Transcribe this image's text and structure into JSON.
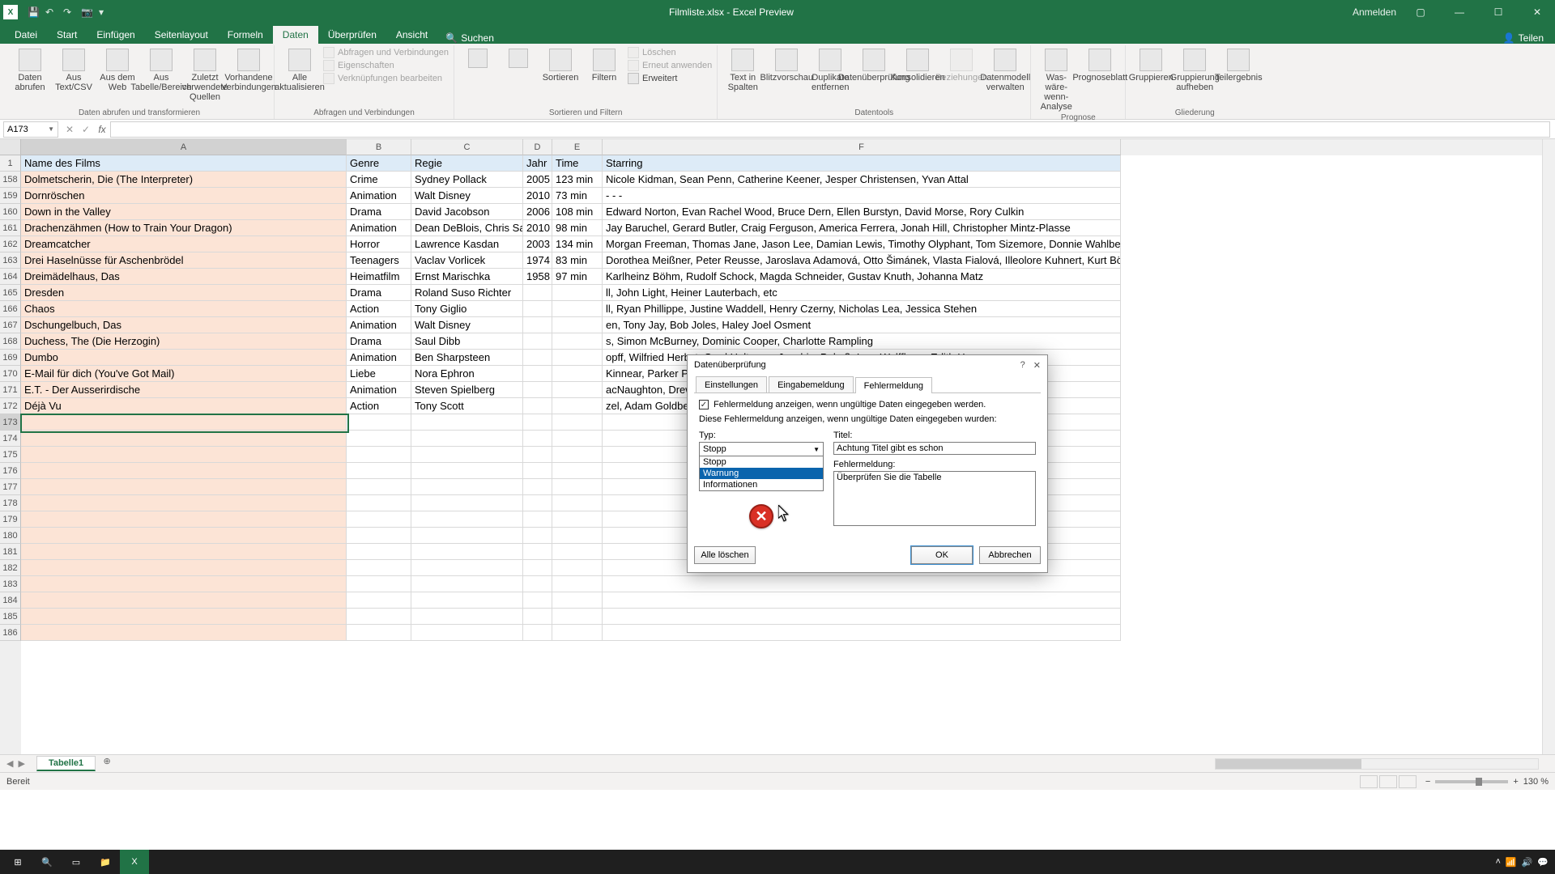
{
  "titlebar": {
    "title": "Filmliste.xlsx - Excel Preview",
    "signin": "Anmelden"
  },
  "ribbon_tabs": [
    "Datei",
    "Start",
    "Einfügen",
    "Seitenlayout",
    "Formeln",
    "Daten",
    "Überprüfen",
    "Ansicht"
  ],
  "ribbon_active_tab": "Daten",
  "search_placeholder": "Suchen",
  "share_label": "Teilen",
  "ribbon": {
    "group_get_transform": "Daten abrufen und transformieren",
    "btn_daten_abrufen": "Daten abrufen",
    "btn_aus_text": "Aus Text/CSV",
    "btn_aus_web": "Aus dem Web",
    "btn_aus_tabelle": "Aus Tabelle/Bereich",
    "btn_zuletzt": "Zuletzt verwendete Quellen",
    "btn_vorhandene": "Vorhandene Verbindungen",
    "group_queries": "Abfragen und Verbindungen",
    "btn_alle_akt": "Alle aktualisieren",
    "row_abfragen": "Abfragen und Verbindungen",
    "row_eigenschaften": "Eigenschaften",
    "row_verknupf": "Verknüpfungen bearbeiten",
    "group_sort": "Sortieren und Filtern",
    "btn_sort": "Sortieren",
    "btn_filter": "Filtern",
    "row_loeschen": "Löschen",
    "row_erneut": "Erneut anwenden",
    "row_erweitert": "Erweitert",
    "group_data_tools": "Datentools",
    "btn_text_sp": "Text in Spalten",
    "btn_blitz": "Blitzvorschau",
    "btn_dup": "Duplikate entfernen",
    "btn_validation": "Datenüberprüfung",
    "btn_konsol": "Konsolidieren",
    "btn_bezieh": "Beziehungen",
    "btn_datamodel": "Datenmodell verwalten",
    "group_forecast": "Prognose",
    "btn_was_waere": "Was-wäre-wenn-Analyse",
    "btn_prognose": "Prognoseblatt",
    "group_outline": "Gliederung",
    "btn_gruppieren": "Gruppieren",
    "btn_grupp_auf": "Gruppierung aufheben",
    "btn_teilergebnis": "Teilergebnis"
  },
  "namebox_value": "A173",
  "columns": [
    "A",
    "B",
    "C",
    "D",
    "E",
    "F"
  ],
  "col_widths_classes": [
    "colA",
    "colB",
    "colC",
    "colD",
    "colE",
    "colF"
  ],
  "header_row": {
    "num": 1,
    "cells": [
      "Name des Films",
      "Genre",
      "Regie",
      "Jahr",
      "Time",
      "Starring"
    ]
  },
  "rows": [
    {
      "num": 158,
      "cells": [
        "Dolmetscherin, Die (The Interpreter)",
        "Crime",
        "Sydney Pollack",
        "2005",
        "123 min",
        "Nicole Kidman, Sean Penn, Catherine Keener, Jesper Christensen, Yvan Attal"
      ]
    },
    {
      "num": 159,
      "cells": [
        "Dornröschen",
        "Animation",
        "Walt Disney",
        "2010",
        "73 min",
        "- - -"
      ]
    },
    {
      "num": 160,
      "cells": [
        "Down in the Valley",
        "Drama",
        "David Jacobson",
        "2006",
        "108 min",
        "Edward Norton, Evan Rachel Wood, Bruce Dern, Ellen Burstyn, David Morse, Rory Culkin"
      ]
    },
    {
      "num": 161,
      "cells": [
        "Drachenzähmen (How to Train Your Dragon)",
        "Animation",
        "Dean DeBlois, Chris Sanders",
        "2010",
        "98 min",
        "Jay Baruchel, Gerard Butler, Craig Ferguson, America Ferrera, Jonah Hill, Christopher Mintz-Plasse"
      ]
    },
    {
      "num": 162,
      "cells": [
        "Dreamcatcher",
        "Horror",
        "Lawrence Kasdan",
        "2003",
        "134 min",
        "Morgan Freeman, Thomas Jane, Jason Lee, Damian Lewis, Timothy Olyphant, Tom Sizemore, Donnie Wahlber"
      ]
    },
    {
      "num": 163,
      "cells": [
        "Drei Haselnüsse für Aschenbrödel",
        "Teenagers",
        "Vaclav Vorlicek",
        "1974",
        "83 min",
        "Dorothea Meißner, Peter Reusse, Jaroslava Adamová, Otto Šimánek, Vlasta Fialová, Illeolore Kuhnert, Kurt Bö"
      ]
    },
    {
      "num": 164,
      "cells": [
        "Dreimädelhaus, Das",
        "Heimatfilm",
        "Ernst Marischka",
        "1958",
        "97 min",
        "Karlheinz Böhm, Rudolf Schock, Magda Schneider, Gustav Knuth, Johanna Matz"
      ]
    },
    {
      "num": 165,
      "cells": [
        "Dresden",
        "Drama",
        "Roland Suso Richter",
        "",
        "",
        "ll, John Light, Heiner Lauterbach, etc"
      ]
    },
    {
      "num": 166,
      "cells": [
        "Chaos",
        "Action",
        "Tony Giglio",
        "",
        "",
        "ll, Ryan Phillippe, Justine Waddell, Henry Czerny, Nicholas Lea, Jessica Stehen"
      ]
    },
    {
      "num": 167,
      "cells": [
        "Dschungelbuch, Das",
        "Animation",
        "Walt Disney",
        "",
        "",
        "en, Tony Jay, Bob Joles, Haley Joel Osment"
      ]
    },
    {
      "num": 168,
      "cells": [
        "Duchess, The (Die Herzogin)",
        "Drama",
        "Saul Dibb",
        "",
        "",
        "s, Simon McBurney, Dominic Cooper, Charlotte Rampling"
      ]
    },
    {
      "num": 169,
      "cells": [
        "Dumbo",
        "Animation",
        "Ben Sharpsteen",
        "",
        "",
        "opff, Wilfried Herbst, Gerd Holtenau, Joachim Pukaß, Inge Wolffberg, Edith Han"
      ]
    },
    {
      "num": 170,
      "cells": [
        "E-Mail für dich (You've Got Mail)",
        "Liebe",
        "Nora Ephron",
        "",
        "",
        "Kinnear, Parker Posey, Jean Stapleton, Steve Zahn"
      ]
    },
    {
      "num": 171,
      "cells": [
        "E.T. - Der Ausserirdische",
        "Animation",
        "Steven Spielberg",
        "",
        "",
        "acNaughton, Drew Barrymore, Peter Coyote, Henry Thomas, Milt Kogan"
      ]
    },
    {
      "num": 172,
      "cells": [
        "Déjà Vu",
        "Action",
        "Tony Scott",
        "",
        "",
        "zel, Adam Goldberg, Bruce Greenwood, Val Kilmer, Paula Patton"
      ]
    }
  ],
  "empty_rows": [
    173,
    174,
    175,
    176,
    177,
    178,
    179,
    180,
    181,
    182,
    183,
    184,
    185,
    186
  ],
  "selected_row": 173,
  "sheet": {
    "name": "Tabelle1"
  },
  "statusbar": {
    "ready": "Bereit",
    "zoom": "130 %"
  },
  "dialog": {
    "title": "Datenüberprüfung",
    "tabs": [
      "Einstellungen",
      "Eingabemeldung",
      "Fehlermeldung"
    ],
    "active_tab": "Fehlermeldung",
    "checkbox_label": "Fehlermeldung anzeigen, wenn ungültige Daten eingegeben werden.",
    "checkbox_checked": true,
    "section_text": "Diese Fehlermeldung anzeigen, wenn ungültige Daten eingegeben wurden:",
    "type_label": "Typ:",
    "type_value": "Stopp",
    "type_options": [
      "Stopp",
      "Warnung",
      "Informationen"
    ],
    "type_highlight_index": 1,
    "title_field_label": "Titel:",
    "title_field_value": "Achtung Titel gibt es schon",
    "message_label": "Fehlermeldung:",
    "message_value": "Überprüfen Sie die Tabelle",
    "clear_all": "Alle löschen",
    "ok": "OK",
    "cancel": "Abbrechen"
  }
}
